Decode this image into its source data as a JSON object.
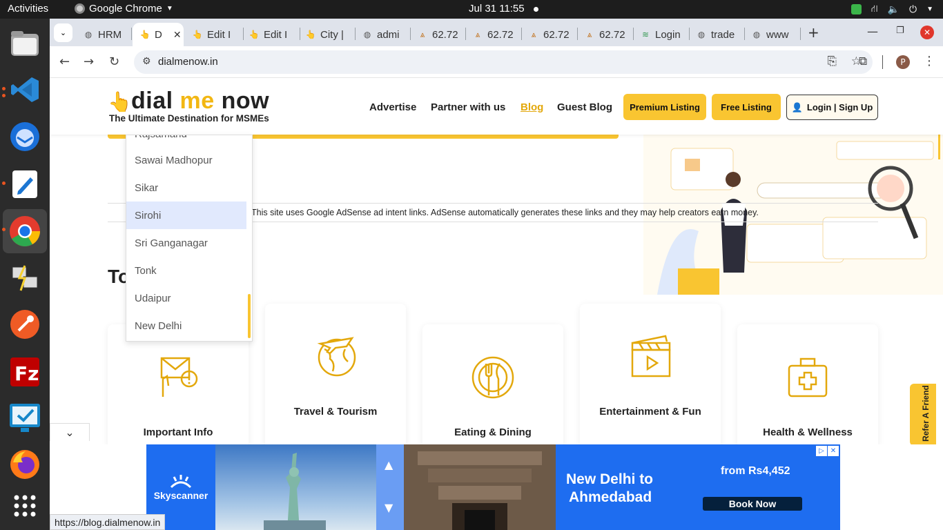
{
  "topbar": {
    "activities": "Activities",
    "app_name": "Google Chrome",
    "datetime": "Jul 31  11:55"
  },
  "tabs": [
    {
      "label": "HRM",
      "active": false
    },
    {
      "label": "D",
      "active": true
    },
    {
      "label": "Edit I",
      "active": false
    },
    {
      "label": "Edit I",
      "active": false
    },
    {
      "label": "City |",
      "active": false
    },
    {
      "label": "admi",
      "active": false
    },
    {
      "label": "62.72",
      "active": false
    },
    {
      "label": "62.72",
      "active": false
    },
    {
      "label": "62.72",
      "active": false
    },
    {
      "label": "62.72",
      "active": false
    },
    {
      "label": "Login",
      "active": false
    },
    {
      "label": "trade",
      "active": false
    },
    {
      "label": "www",
      "active": false
    }
  ],
  "address": {
    "url": "dialmenow.in",
    "profile_initial": "P"
  },
  "site": {
    "logo_text_1": "dial",
    "logo_text_2": "me",
    "logo_text_3": "now",
    "tagline": "The Ultimate Destination for MSMEs",
    "nav": [
      "Advertise",
      "Partner with us",
      "Blog",
      "Guest Blog"
    ],
    "premium_btn": "Premium Listing",
    "free_btn": "Free Listing",
    "login_btn": "Login | Sign Up",
    "adsense_notice": "This site uses Google AdSense ad intent links. AdSense automatically generates these links and they may help creators earn money.",
    "section_heading_partial": "To"
  },
  "dropdown": {
    "partial_top": "Rajsamand",
    "items": [
      "Sawai Madhopur",
      "Sikar",
      "Sirohi",
      "Sri Ganganagar",
      "Tonk",
      "Udaipur",
      "New Delhi"
    ],
    "selected": "Sirohi"
  },
  "categories": [
    {
      "label": "Important Info",
      "icon": "envelope-info-icon"
    },
    {
      "label": "Travel & Tourism",
      "icon": "globe-plane-icon"
    },
    {
      "label": "Eating & Dining",
      "icon": "plate-cutlery-icon"
    },
    {
      "label": "Entertainment & Fun",
      "icon": "clapperboard-icon"
    },
    {
      "label": "Health & Wellness",
      "icon": "medical-kit-icon"
    }
  ],
  "refer_tab": "Refer A Friend",
  "ad": {
    "brand": "Skyscanner",
    "headline_1": "New Delhi to",
    "headline_2": "Ahmedabad",
    "price": "from Rs4,452",
    "cta": "Book Now"
  },
  "status_url": "https://blog.dialmenow.in",
  "colors": {
    "brand_yellow": "#f9c531",
    "ad_blue": "#1e6df0",
    "link_active": "#e3a80c"
  }
}
